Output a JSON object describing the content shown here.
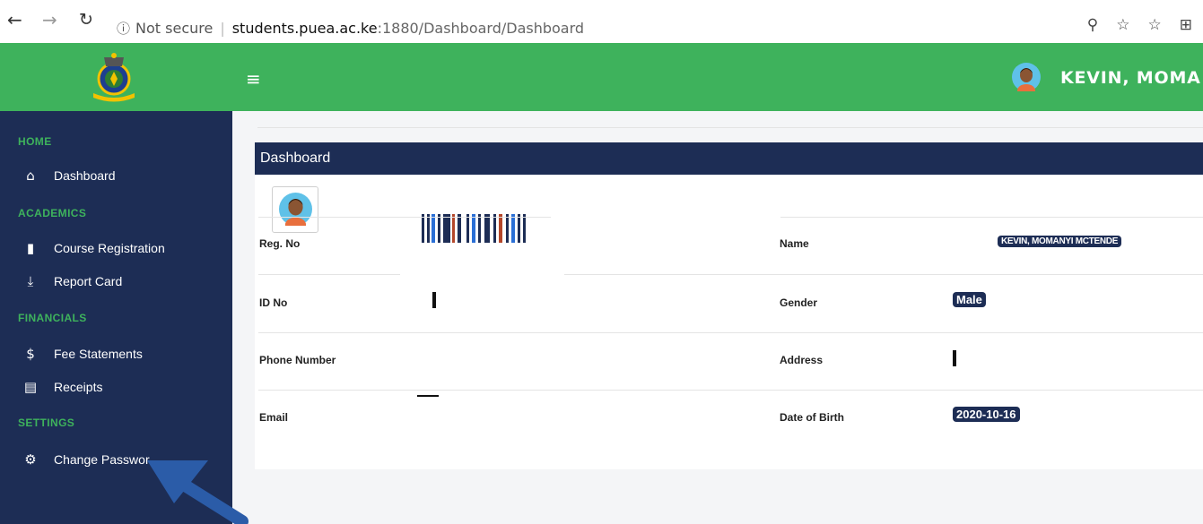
{
  "browser": {
    "back": "←",
    "forward": "→",
    "refresh": "↻",
    "info_icon": "ⓘ",
    "not_secure": "Not secure",
    "separator": "|",
    "host": "students.puea.ac.ke",
    "path": ":1880/Dashboard/Dashboard",
    "icons": [
      "key-icon",
      "star-icon",
      "favorites-icon",
      "collections-icon"
    ],
    "icon_glyphs": [
      "⚲",
      "☆",
      "☆",
      "⊞"
    ]
  },
  "header": {
    "hamburger": "≡",
    "user_name": "KEVIN, MOMA"
  },
  "sidebar": {
    "sections": [
      {
        "label": "HOME",
        "items": [
          {
            "label": "Dashboard",
            "icon": "home-icon",
            "glyph": "⌂"
          }
        ]
      },
      {
        "label": "ACADEMICS",
        "items": [
          {
            "label": "Course Registration",
            "icon": "books-icon",
            "glyph": "▮"
          },
          {
            "label": "Report Card",
            "icon": "download-icon",
            "glyph": "⤓"
          }
        ]
      },
      {
        "label": "FINANCIALS",
        "items": [
          {
            "label": "Fee Statements",
            "icon": "dollar-icon",
            "glyph": "$"
          },
          {
            "label": "Receipts",
            "icon": "receipt-icon",
            "glyph": "▤"
          }
        ]
      },
      {
        "label": "SETTINGS",
        "items": [
          {
            "label": "Change Passwor",
            "icon": "gear-icon",
            "glyph": "⚙"
          }
        ]
      }
    ]
  },
  "dashboard": {
    "title": "Dashboard",
    "fields": {
      "reg_no_label": "Reg. No",
      "name_label": "Name",
      "name_value": "KEVIN, MOMANYI MCTENDE",
      "id_no_label": "ID No",
      "gender_label": "Gender",
      "gender_value": "Male",
      "phone_label": "Phone Number",
      "address_label": "Address",
      "email_label": "Email",
      "dob_label": "Date of Birth",
      "dob_value": "2020-10-16"
    }
  },
  "colors": {
    "header_green": "#3eb25c",
    "sidebar_navy": "#1d2d55",
    "arrow_blue": "#2b5ca8"
  }
}
